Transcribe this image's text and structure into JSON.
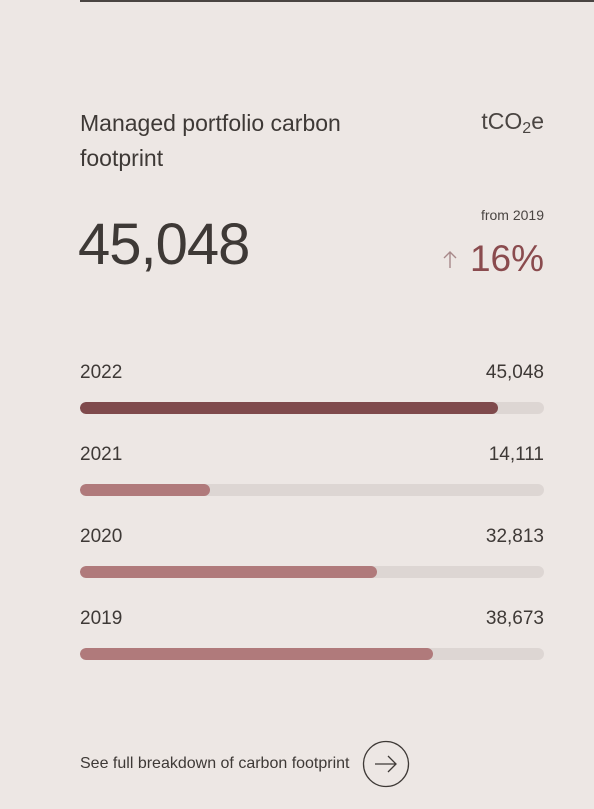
{
  "card": {
    "title": "Managed portfolio carbon footprint",
    "unit_prefix": "tCO",
    "unit_sub": "2",
    "unit_suffix": "e",
    "headline_value": "45,048",
    "change_label": "from 2019",
    "change_direction_icon": "arrow-up-icon",
    "change_value": "16%"
  },
  "years": [
    {
      "year": "2022",
      "value": "45,048",
      "fill_fraction": 0.9,
      "highlight": true
    },
    {
      "year": "2021",
      "value": "14,111",
      "fill_fraction": 0.28,
      "highlight": false
    },
    {
      "year": "2020",
      "value": "32,813",
      "fill_fraction": 0.64,
      "highlight": false
    },
    {
      "year": "2019",
      "value": "38,673",
      "fill_fraction": 0.76,
      "highlight": false
    }
  ],
  "colors": {
    "current_bar": "#7f4a4c",
    "past_bar": "#b07a7b",
    "track": "#ddd6d3",
    "change_accent": "#8a4b4e",
    "background": "#ede7e4"
  },
  "footer": {
    "link_label": "See full breakdown of carbon footprint",
    "link_icon": "circle-arrow-right-icon"
  }
}
